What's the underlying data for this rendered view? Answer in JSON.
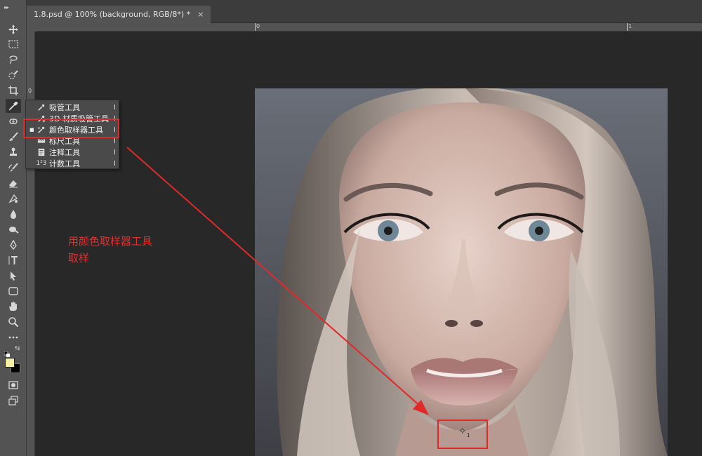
{
  "toolbar": {
    "tools": [
      {
        "name": "move-tool-icon"
      },
      {
        "name": "marquee-tool-icon"
      },
      {
        "name": "lasso-tool-icon"
      },
      {
        "name": "quick-select-tool-icon"
      },
      {
        "name": "crop-tool-icon"
      },
      {
        "name": "eyedropper-tool-icon"
      },
      {
        "name": "healing-tool-icon"
      },
      {
        "name": "brush-tool-icon"
      },
      {
        "name": "stamp-tool-icon"
      },
      {
        "name": "history-brush-tool-icon"
      },
      {
        "name": "eraser-tool-icon"
      },
      {
        "name": "gradient-tool-icon"
      },
      {
        "name": "blur-tool-icon"
      },
      {
        "name": "dodge-tool-icon"
      },
      {
        "name": "pen-tool-icon"
      },
      {
        "name": "type-tool-icon"
      },
      {
        "name": "path-select-tool-icon"
      },
      {
        "name": "shape-tool-icon"
      },
      {
        "name": "hand-tool-icon"
      },
      {
        "name": "zoom-tool-icon"
      },
      {
        "name": "more-tools-icon"
      }
    ],
    "foreground_color": "#f5f0a4",
    "background_color": "#000000"
  },
  "document_tab": {
    "title": "1.8.psd @ 100% (background, RGB/8*) *",
    "close": "×"
  },
  "rulers": {
    "top_labels": [
      "0",
      "1"
    ],
    "left_label": "0"
  },
  "flyout_menu": {
    "items": [
      {
        "icon": "eyedropper-icon",
        "label": "吸管工具",
        "shortcut": "I",
        "selected": false
      },
      {
        "icon": "3d-material-eyedropper-icon",
        "label": "3D 材质吸管工具",
        "shortcut": "I",
        "selected": false
      },
      {
        "icon": "color-sampler-icon",
        "label": "颜色取样器工具",
        "shortcut": "I",
        "selected": true
      },
      {
        "icon": "ruler-icon",
        "label": "标尺工具",
        "shortcut": "I",
        "selected": false
      },
      {
        "icon": "note-icon",
        "label": "注释工具",
        "shortcut": "I",
        "selected": false
      },
      {
        "icon": "count-icon",
        "label": "计数工具",
        "shortcut": "I",
        "selected": false
      }
    ],
    "count_glyph": "1²3"
  },
  "annotation": {
    "line1": "用颜色取样器工具",
    "line2": "取样",
    "color": "#e02a2a"
  },
  "sampler_marker": {
    "glyph": "✧",
    "index": "1"
  }
}
